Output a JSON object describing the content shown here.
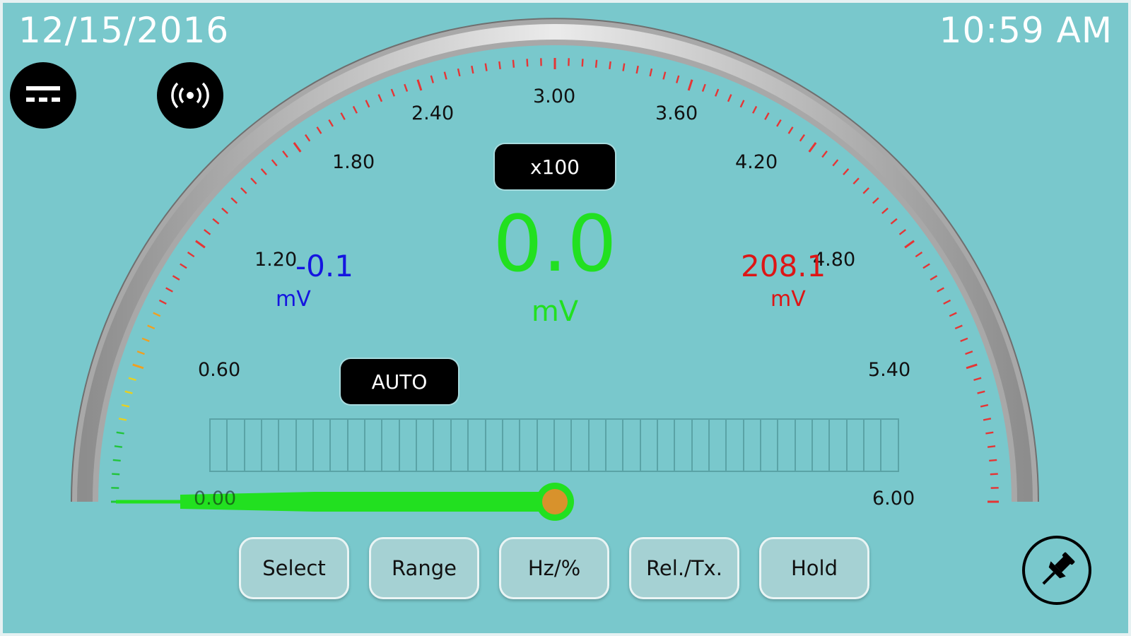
{
  "status_bar": {
    "date": "12/15/2016",
    "time": "10:59 AM"
  },
  "toolbar": {
    "mode_icon": "dc-voltage-icon",
    "signal_icon": "wireless-signal-icon"
  },
  "gauge": {
    "scale_labels": [
      "0.00",
      "0.60",
      "1.20",
      "1.80",
      "2.40",
      "3.00",
      "3.60",
      "4.20",
      "4.80",
      "5.40",
      "6.00"
    ],
    "scale_max": 6.0,
    "multiplier": "x100",
    "range_mode": "AUTO",
    "needle_value": 0.0,
    "bargraph_fill_fraction": 0.0,
    "colors": {
      "needle": "#22e020",
      "low_ticks": "#22c43c",
      "mid_ticks": "#e8d020",
      "high_ticks": "#e53535"
    }
  },
  "reading": {
    "main_value": "0.0",
    "main_unit": "mV",
    "min_value": "-0.1",
    "min_unit": "mV",
    "max_value": "208.1",
    "max_unit": "mV"
  },
  "buttons": {
    "select": "Select",
    "range": "Range",
    "hz_percent": "Hz/%",
    "rel_tx": "Rel./Tx.",
    "hold": "Hold"
  },
  "pin_icon": "pushpin-icon"
}
